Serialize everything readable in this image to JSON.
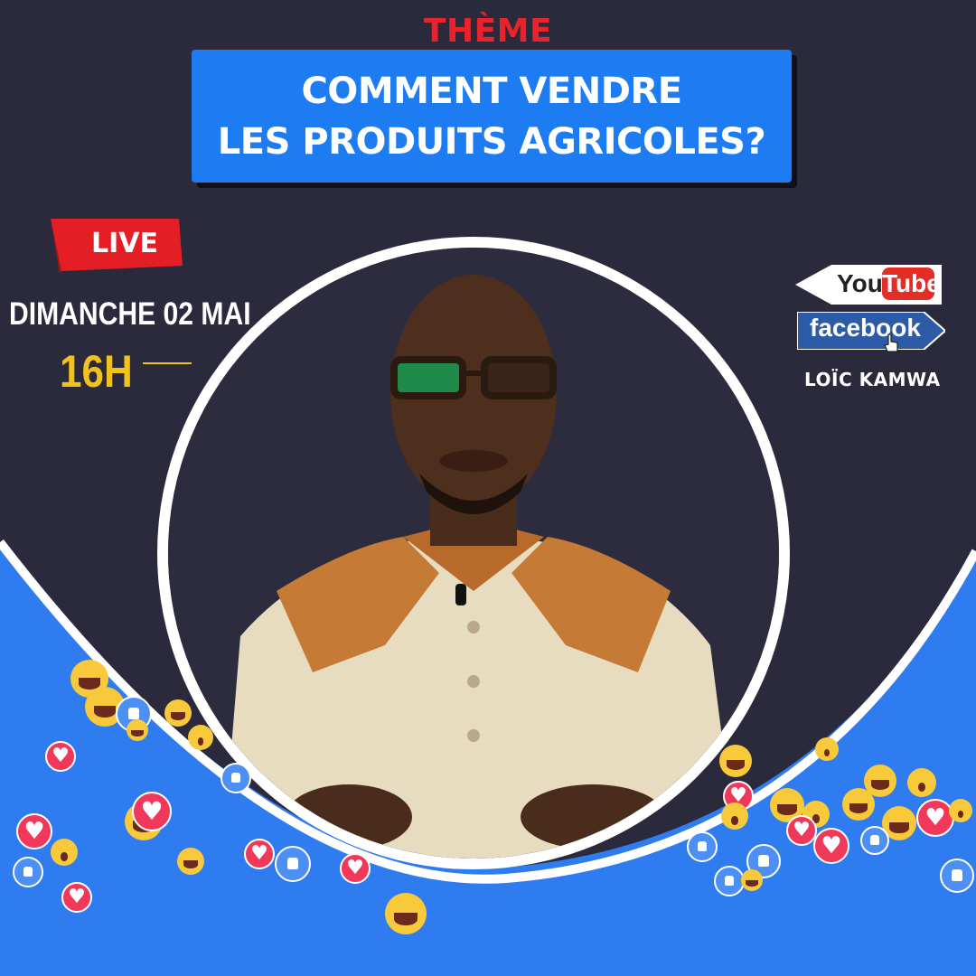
{
  "header": {
    "theme_label": "THÈME",
    "title_line1": "COMMENT VENDRE",
    "title_line2": "LES PRODUITS AGRICOLES?"
  },
  "event": {
    "live_badge": "LIVE",
    "date": "DIMANCHE 02 MAI",
    "hour": "16H"
  },
  "platforms": {
    "youtube_you": "You",
    "youtube_tube": "Tube",
    "facebook": "facebook",
    "host_name": "LOÏC KAMWA"
  },
  "colors": {
    "background": "#2a2a3c",
    "accent_blue": "#1d7cf2",
    "theme_red": "#e8232b",
    "hour_yellow": "#f2c21b"
  },
  "reactions": [
    "like-icon",
    "love-icon",
    "haha-icon",
    "wow-icon"
  ]
}
